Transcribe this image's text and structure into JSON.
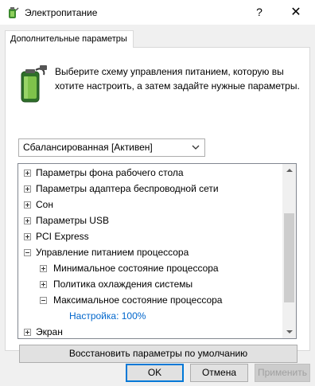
{
  "window": {
    "title": "Электропитание",
    "help_glyph": "?",
    "close_glyph": "✕"
  },
  "tab": {
    "label": "Дополнительные параметры"
  },
  "description": "Выберите схему управления питанием, которую вы хотите настроить, а затем задайте нужные параметры.",
  "scheme": {
    "selected": "Сбалансированная [Активен]"
  },
  "tree": {
    "rows": [
      {
        "label": "Параметры фона рабочего стола",
        "level": 0,
        "expander": "plus"
      },
      {
        "label": "Параметры адаптера беспроводной сети",
        "level": 0,
        "expander": "plus"
      },
      {
        "label": "Сон",
        "level": 0,
        "expander": "plus"
      },
      {
        "label": "Параметры USB",
        "level": 0,
        "expander": "plus"
      },
      {
        "label": "PCI Express",
        "level": 0,
        "expander": "plus"
      },
      {
        "label": "Управление питанием процессора",
        "level": 0,
        "expander": "minus"
      },
      {
        "label": "Минимальное состояние процессора",
        "level": 1,
        "expander": "plus"
      },
      {
        "label": "Политика охлаждения системы",
        "level": 1,
        "expander": "plus"
      },
      {
        "label": "Максимальное состояние процессора",
        "level": 1,
        "expander": "minus"
      },
      {
        "label": "Настройка: 100%",
        "level": 2,
        "expander": "none"
      },
      {
        "label": "Экран",
        "level": 0,
        "expander": "plus"
      }
    ]
  },
  "buttons": {
    "restore": "Восстановить параметры по умолчанию",
    "ok": "OK",
    "cancel": "Отмена",
    "apply": "Применить"
  },
  "colors": {
    "accent": "#0078d7",
    "link": "#0066cc",
    "dialog_bg": "#f0f0f0"
  },
  "icons": {
    "app": "power-options-icon",
    "header": "battery-plug-icon"
  }
}
